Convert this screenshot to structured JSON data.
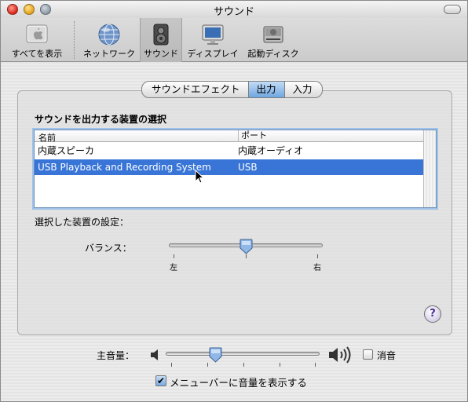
{
  "window": {
    "title": "サウンド"
  },
  "toolbar": {
    "items": [
      {
        "label": "すべてを表示",
        "icon": "show-all-icon"
      },
      {
        "label": "ネットワーク",
        "icon": "network-icon"
      },
      {
        "label": "サウンド",
        "icon": "speaker-icon",
        "selected": true
      },
      {
        "label": "ディスプレイ",
        "icon": "display-icon"
      },
      {
        "label": "起動ディスク",
        "icon": "startup-disk-icon"
      }
    ]
  },
  "tabs": [
    {
      "label": "サウンドエフェクト",
      "active": false
    },
    {
      "label": "出力",
      "active": true
    },
    {
      "label": "入力",
      "active": false
    }
  ],
  "output": {
    "heading": "サウンドを出力する装置の選択",
    "table": {
      "columns": [
        "名前",
        "ポート"
      ],
      "rows": [
        {
          "name": "内蔵スピーカ",
          "port": "内蔵オーディオ",
          "selected": false
        },
        {
          "name": "USB Playback and Recording System",
          "port": "USB",
          "selected": true
        }
      ]
    },
    "settings_label": "選択した装置の設定：",
    "balance": {
      "label": "バランス：",
      "left_label": "左",
      "right_label": "右",
      "value": 0.5
    }
  },
  "master_volume": {
    "label": "主音量：",
    "value": 0.33,
    "mute_label": "消音",
    "mute_checked": false
  },
  "menubar_option": {
    "label": "メニューバーに音量を表示する",
    "checked": true
  },
  "help": {
    "label": "?"
  },
  "colors": {
    "selection": "#3875d7",
    "tab_active": "#6fa6e0"
  }
}
